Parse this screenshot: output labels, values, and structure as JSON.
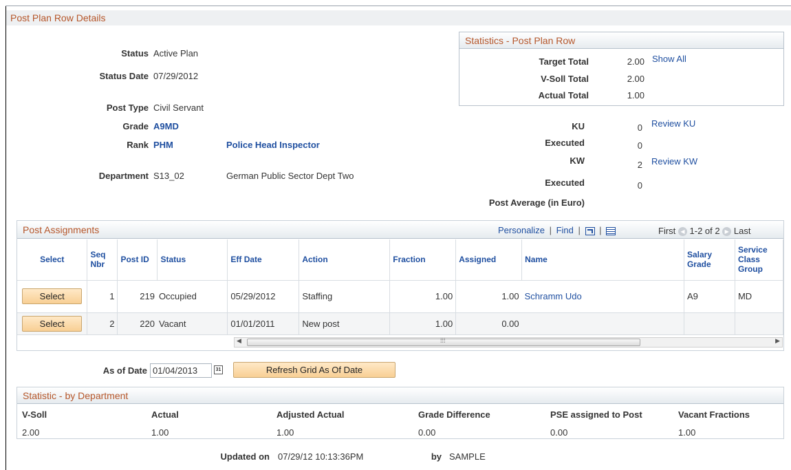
{
  "page_title": "Post Plan Row Details",
  "details": {
    "status_label": "Status",
    "status": "Active Plan",
    "status_date_label": "Status Date",
    "status_date": "07/29/2012",
    "post_type_label": "Post Type",
    "post_type": "Civil Servant",
    "grade_label": "Grade",
    "grade": "A9MD",
    "rank_label": "Rank",
    "rank": "PHM",
    "rank_desc": "Police Head Inspector",
    "department_label": "Department",
    "department": "S13_02",
    "department_desc": "German Public Sector Dept Two"
  },
  "statistics_box": {
    "title": "Statistics - Post Plan Row",
    "target_total_label": "Target Total",
    "target_total": "2.00",
    "show_all": "Show All",
    "vsoll_total_label": "V-Soll Total",
    "vsoll_total": "2.00",
    "actual_total_label": "Actual Total",
    "actual_total": "1.00"
  },
  "ku_kw": {
    "ku_label": "KU",
    "ku": "0",
    "review_ku": "Review KU",
    "executed1_label": "Executed",
    "executed1": "0",
    "kw_label": "KW",
    "kw": "2",
    "review_kw": "Review KW",
    "executed2_label": "Executed",
    "executed2": "0",
    "post_average_label": "Post Average (in Euro)"
  },
  "assignments": {
    "title": "Post Assignments",
    "personalize": "Personalize",
    "sep1": "|",
    "find": "Find",
    "sep2": "|",
    "sep3": "|",
    "first": "First",
    "range": "1-2 of 2",
    "last": "Last",
    "columns": {
      "select": "Select",
      "seq_nbr": "Seq Nbr",
      "post_id": "Post ID",
      "status": "Status",
      "eff_date": "Eff Date",
      "action": "Action",
      "fraction": "Fraction",
      "assigned": "Assigned",
      "name": "Name",
      "salary_grade": "Salary Grade",
      "service_class_group": "Service Class Group"
    },
    "rows": [
      {
        "select": "Select",
        "seq": "1",
        "post_id": "219",
        "status": "Occupied",
        "eff_date": "05/29/2012",
        "action": "Staffing",
        "fraction": "1.00",
        "assigned": "1.00",
        "name": "Schramm Udo",
        "salary_grade": "A9",
        "scg": "MD"
      },
      {
        "select": "Select",
        "seq": "2",
        "post_id": "220",
        "status": "Vacant",
        "eff_date": "01/01/2011",
        "action": "New post",
        "fraction": "1.00",
        "assigned": "0.00",
        "name": "",
        "salary_grade": "",
        "scg": ""
      }
    ]
  },
  "as_of": {
    "label": "As of Date",
    "value": "01/04/2013",
    "refresh_button": "Refresh Grid As Of Date",
    "calendar_glyph": "31"
  },
  "dept_stats": {
    "title": "Statistic - by Department",
    "headers": [
      "V-Soll",
      "Actual",
      "Adjusted Actual",
      "Grade Difference",
      "PSE assigned to Post",
      "Vacant Fractions"
    ],
    "values": [
      "2.00",
      "1.00",
      "1.00",
      "0.00",
      "0.00",
      "1.00"
    ]
  },
  "footer": {
    "updated_on_label": "Updated on",
    "updated_on": "07/29/12 10:13:36PM",
    "by_label": "by",
    "by": "SAMPLE"
  }
}
